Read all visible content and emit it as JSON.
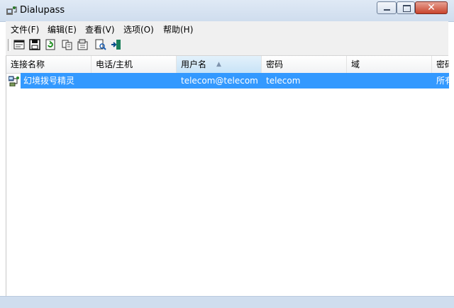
{
  "window": {
    "title": "Dialupass",
    "close_glyph": "✕"
  },
  "menu": [
    {
      "label": "文件(F)"
    },
    {
      "label": "编辑(E)"
    },
    {
      "label": "查看(V)"
    },
    {
      "label": "选项(O)"
    },
    {
      "label": "帮助(H)"
    }
  ],
  "toolbar": {
    "buttons": [
      {
        "icon": "html-report-icon"
      },
      {
        "icon": "save-icon"
      },
      {
        "icon": "refresh-icon"
      },
      {
        "icon": "copy-icon"
      },
      {
        "icon": "properties-icon"
      },
      {
        "icon": "find-icon"
      },
      {
        "icon": "exit-icon"
      }
    ]
  },
  "table": {
    "columns": [
      "连接名称",
      "电话/主机",
      "用户名",
      "密码",
      "域",
      "密码"
    ],
    "sorted_column_index": 2,
    "rows": [
      {
        "icon": "dialup-connection-icon",
        "cells": [
          "幻境拨号精灵",
          "",
          "telecom@telecom",
          "telecom",
          "",
          "所有"
        ],
        "selected": true
      }
    ]
  },
  "colors": {
    "selection": "#3399ff",
    "titlebar": "#dfe9f5"
  }
}
